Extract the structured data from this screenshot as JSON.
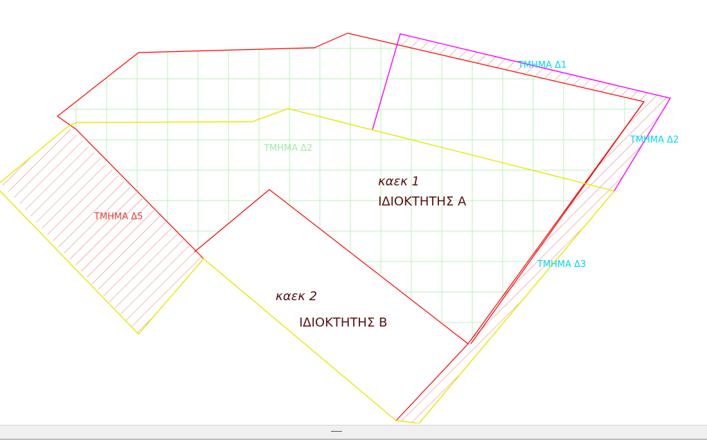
{
  "labels": {
    "tmima_d1": "ΤΜΗΜΑ Δ1",
    "tmima_d2_right": "ΤΜΗΜΑ Δ2",
    "tmima_d2_center": "ΤΜΗΜΑ Δ2",
    "tmima_d3": "ΤΜΗΜΑ Δ3",
    "tmima_d5": "ΤΜΗΜΑ Δ5",
    "kaek1": "καεκ 1",
    "owner_a": "ΙΔΙΟΚΤΗΤΗΣ Α",
    "kaek2": "καεκ 2",
    "owner_b": "ΙΔΙΟΚΤΗΤΗΣ Β"
  },
  "colors": {
    "parcel_boundary": "#ff0000",
    "yellow_boundary": "#e8e800",
    "magenta_boundary": "#ff00ff",
    "grid": "#b8f0b8",
    "hatch": "#e87070",
    "cyan_text": "#00d8f0",
    "red_text": "#e84040",
    "green_text": "#a8e8a8",
    "dark_text": "#5a1010"
  }
}
